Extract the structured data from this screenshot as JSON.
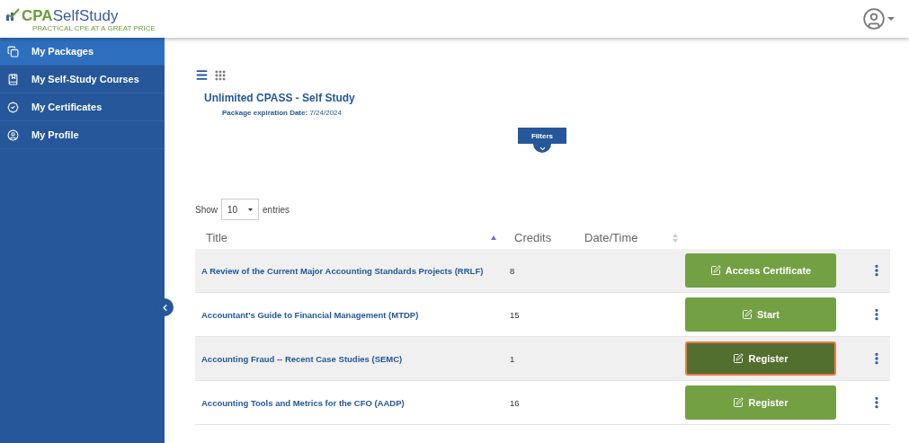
{
  "logo": {
    "brand_strong": "CPA",
    "brand_light": "SelfStudy",
    "tagline": "PRACTICAL CPE AT A GREAT PRICE"
  },
  "sidebar": {
    "items": [
      {
        "label": "My Packages",
        "selected": true
      },
      {
        "label": "My Self-Study Courses",
        "selected": false
      },
      {
        "label": "My Certificates",
        "selected": false
      },
      {
        "label": "My Profile",
        "selected": false
      }
    ]
  },
  "view_toggle": {
    "list_selected": true
  },
  "package": {
    "title": "Unlimited CPASS - Self Study",
    "expiration_label": "Package expiration Date:",
    "expiration_value": "7/24/2024"
  },
  "filters": {
    "label": "Filters"
  },
  "entries": {
    "show": "Show",
    "value": "10",
    "suffix": "entries"
  },
  "table": {
    "columns": [
      {
        "label": "Title",
        "sortable": true,
        "sorted_ascending": true
      },
      {
        "label": "Credits",
        "sortable": false,
        "sorted_ascending": false
      },
      {
        "label": "Date/Time",
        "sortable": true,
        "sorted_ascending": false
      }
    ],
    "rows": [
      {
        "title": "A Review of the Current Major Accounting Standards Projects (RRLF)",
        "credits": "8",
        "action": "Access Certificate",
        "focused": false
      },
      {
        "title": "Accountant's Guide to Financial Management (MTDP)",
        "credits": "15",
        "action": "Start",
        "focused": false
      },
      {
        "title": "Accounting Fraud -- Recent Case Studies (SEMC)",
        "credits": "1",
        "action": "Register",
        "focused": true
      },
      {
        "title": "Accounting Tools and Metrics for the CFO (AADP)",
        "credits": "16",
        "action": "Register",
        "focused": false
      }
    ]
  }
}
